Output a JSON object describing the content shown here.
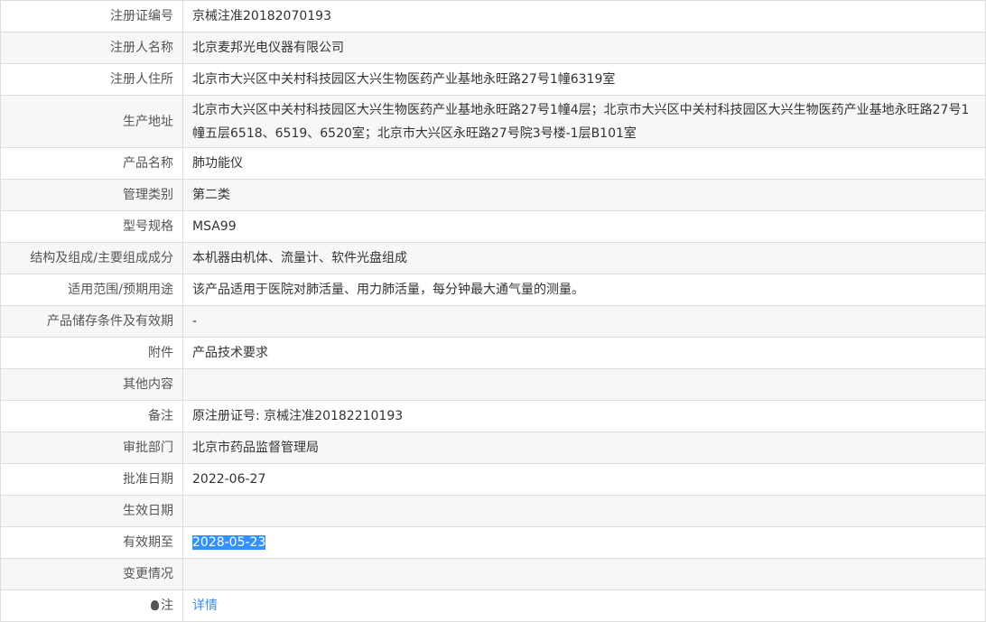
{
  "rows": [
    {
      "label": "注册证编号",
      "value": "京械注准20182070193"
    },
    {
      "label": "注册人名称",
      "value": "北京麦邦光电仪器有限公司"
    },
    {
      "label": "注册人住所",
      "value": "北京市大兴区中关村科技园区大兴生物医药产业基地永旺路27号1幢6319室"
    },
    {
      "label": "生产地址",
      "value": "北京市大兴区中关村科技园区大兴生物医药产业基地永旺路27号1幢4层；北京市大兴区中关村科技园区大兴生物医药产业基地永旺路27号1幢五层6518、6519、6520室；北京市大兴区永旺路27号院3号楼-1层B101室"
    },
    {
      "label": "产品名称",
      "value": "肺功能仪"
    },
    {
      "label": "管理类别",
      "value": "第二类"
    },
    {
      "label": "型号规格",
      "value": "MSA99"
    },
    {
      "label": "结构及组成/主要组成成分",
      "value": "本机器由机体、流量计、软件光盘组成"
    },
    {
      "label": "适用范围/预期用途",
      "value": "该产品适用于医院对肺活量、用力肺活量，每分钟最大通气量的测量。"
    },
    {
      "label": "产品储存条件及有效期",
      "value": "-"
    },
    {
      "label": "附件",
      "value": "产品技术要求"
    },
    {
      "label": "其他内容",
      "value": ""
    },
    {
      "label": "备注",
      "value": "原注册证号: 京械注准20182210193"
    },
    {
      "label": "审批部门",
      "value": "北京市药品监督管理局"
    },
    {
      "label": "批准日期",
      "value": "2022-06-27"
    },
    {
      "label": "生效日期",
      "value": ""
    },
    {
      "label": "有效期至",
      "value": "2028-05-23"
    },
    {
      "label": "变更情况",
      "value": ""
    }
  ],
  "note": {
    "label": "注",
    "link": "详情",
    "icon": "lightbulb-icon"
  }
}
